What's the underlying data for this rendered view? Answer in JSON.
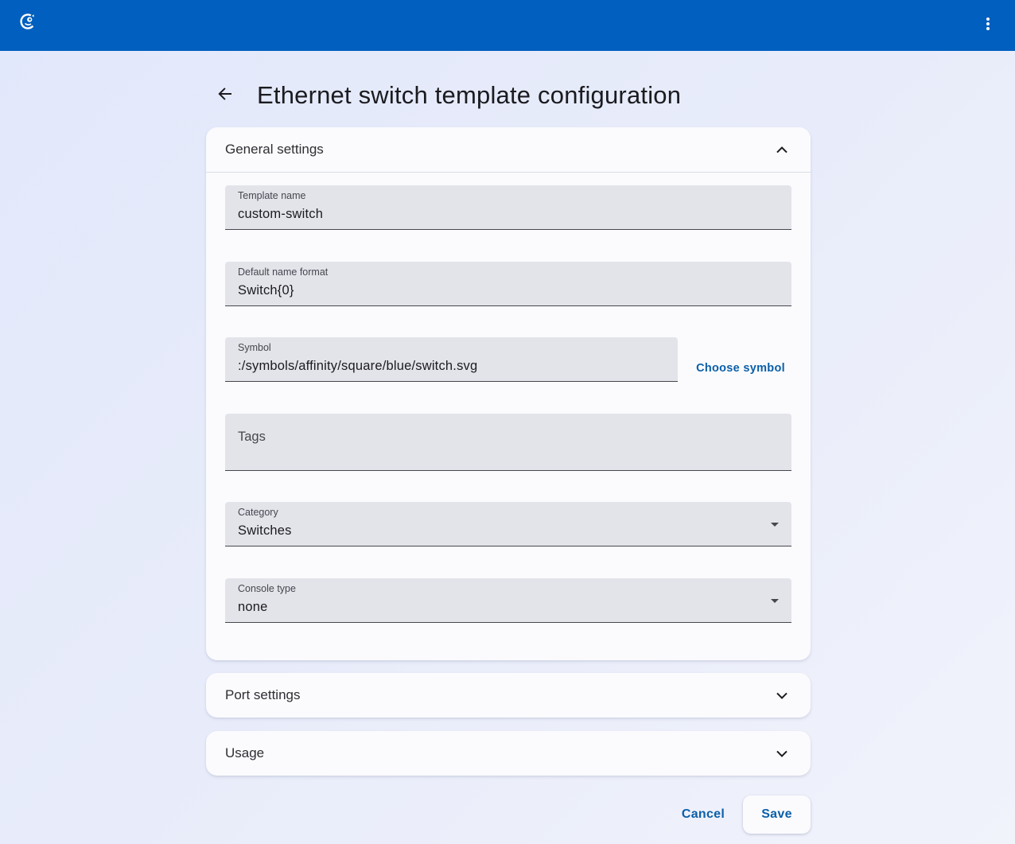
{
  "app": {
    "logo_icon": "gns3-chameleon-logo",
    "menu_icon": "more-vert-icon"
  },
  "page": {
    "title": "Ethernet switch template configuration",
    "back_icon": "arrow-back-icon"
  },
  "general_settings": {
    "title": "General settings",
    "expanded": true,
    "template_name": {
      "label": "Template name",
      "value": "custom-switch"
    },
    "default_name_format": {
      "label": "Default name format",
      "value": "Switch{0}"
    },
    "symbol": {
      "label": "Symbol",
      "value": ":/symbols/affinity/square/blue/switch.svg"
    },
    "choose_symbol_label": "Choose symbol",
    "tags": {
      "placeholder": "Tags"
    },
    "category": {
      "label": "Category",
      "value": "Switches"
    },
    "console_type": {
      "label": "Console type",
      "value": "none"
    }
  },
  "port_settings": {
    "title": "Port settings",
    "expanded": false
  },
  "usage": {
    "title": "Usage",
    "expanded": false
  },
  "actions": {
    "cancel_label": "Cancel",
    "save_label": "Save"
  },
  "colors": {
    "toolbar": "#005fbf",
    "accent": "#0b5fa8",
    "field_bg": "#e3e4ea",
    "panel_bg": "#fbfbfe"
  }
}
